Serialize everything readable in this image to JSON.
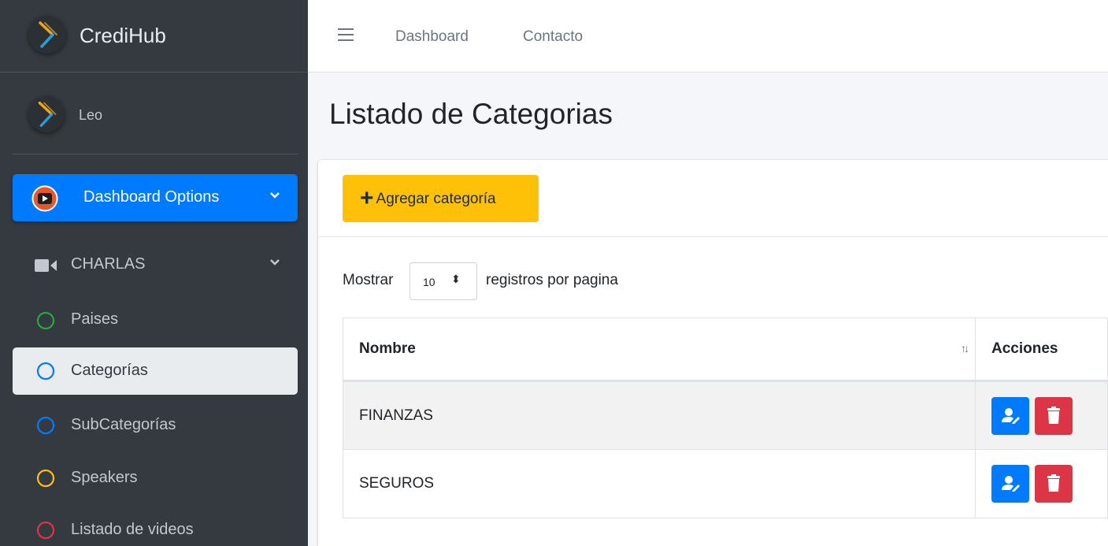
{
  "sidebar": {
    "brand_name": "CrediHub",
    "user_name": "Leo",
    "items": [
      {
        "label": "Dashboard Options",
        "icon": "youtube-play-icon",
        "active": true,
        "expandable": true
      },
      {
        "label": "CHARLAS",
        "icon": "video-camera-icon",
        "expandable": true
      },
      {
        "label": "Paises",
        "icon": "circle-icon",
        "icon_color": "#28a745"
      },
      {
        "label": "Categorías",
        "icon": "circle-icon",
        "icon_color": "#007bff",
        "selected": true
      },
      {
        "label": "SubCategorías",
        "icon": "circle-icon",
        "icon_color": "#007bff"
      },
      {
        "label": "Speakers",
        "icon": "circle-icon",
        "icon_color": "#ffc107"
      },
      {
        "label": "Listado de videos",
        "icon": "circle-icon",
        "icon_color": "#dc3545"
      }
    ]
  },
  "topnav": {
    "links": [
      "Dashboard",
      "Contacto"
    ]
  },
  "page": {
    "title": "Listado de Categorias",
    "add_button": "Agregar categoría",
    "length_prefix": "Mostrar",
    "length_value": "10",
    "length_suffix": "registros por pagina"
  },
  "table": {
    "headers": [
      "Nombre",
      "Acciones"
    ],
    "rows": [
      {
        "nombre": "FINANZAS"
      },
      {
        "nombre": "SEGUROS"
      }
    ]
  },
  "colors": {
    "sidebar_bg": "#343a40",
    "primary": "#007bff",
    "warning": "#ffc107",
    "danger": "#dc3545",
    "logo_orange": "#f0a31c",
    "logo_blue": "#2b9ed8"
  }
}
